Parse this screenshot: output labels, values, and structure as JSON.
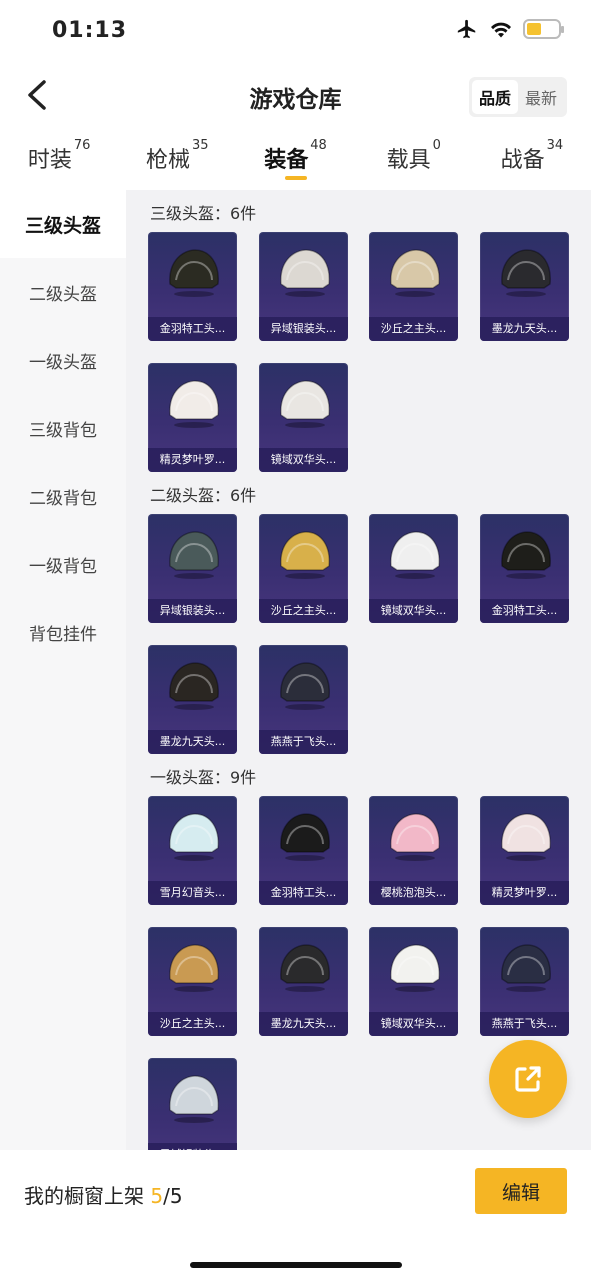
{
  "status": {
    "time": "01:13"
  },
  "nav": {
    "title": "游戏仓库",
    "sort": [
      "品质",
      "最新"
    ]
  },
  "tabs": [
    {
      "label": "时装",
      "count": "76"
    },
    {
      "label": "枪械",
      "count": "35"
    },
    {
      "label": "装备",
      "count": "48"
    },
    {
      "label": "载具",
      "count": "0"
    },
    {
      "label": "战备",
      "count": "34"
    }
  ],
  "sidebar": [
    "三级头盔",
    "二级头盔",
    "一级头盔",
    "三级背包",
    "二级背包",
    "一级背包",
    "背包挂件"
  ],
  "sections": [
    {
      "title": "三级头盔：6件",
      "items": [
        "金羽特工头...",
        "异域银装头...",
        "沙丘之主头...",
        "墨龙九天头...",
        "精灵梦叶罗...",
        "镜域双华头..."
      ]
    },
    {
      "title": "二级头盔：6件",
      "items": [
        "异域银装头...",
        "沙丘之主头...",
        "镜域双华头...",
        "金羽特工头...",
        "墨龙九天头...",
        "燕燕于飞头..."
      ]
    },
    {
      "title": "一级头盔：9件",
      "items": [
        "雪月幻音头...",
        "金羽特工头...",
        "樱桃泡泡头...",
        "精灵梦叶罗...",
        "沙丘之主头...",
        "墨龙九天头...",
        "镜域双华头...",
        "燕燕于飞头...",
        "异域银装头..."
      ]
    }
  ],
  "helmet_colors": {
    "s0": [
      "#2b2b22",
      "#dcd8d2",
      "#d8c8a8",
      "#2a2a2e",
      "#f1ece8",
      "#e9e6e2"
    ],
    "s1": [
      "#4a5a5a",
      "#d8b04a",
      "#efefef",
      "#1e1e1a",
      "#2a2622",
      "#2b2d3a"
    ],
    "s2": [
      "#d6ecf0",
      "#1b1b1b",
      "#f2b8c8",
      "#f0e2e2",
      "#c99a52",
      "#2a2a2c",
      "#f2f2ef",
      "#2a2e44",
      "#cfd6dc"
    ]
  },
  "bottom": {
    "label": "我的橱窗上架",
    "current": "5",
    "total": "/5",
    "edit": "编辑"
  }
}
